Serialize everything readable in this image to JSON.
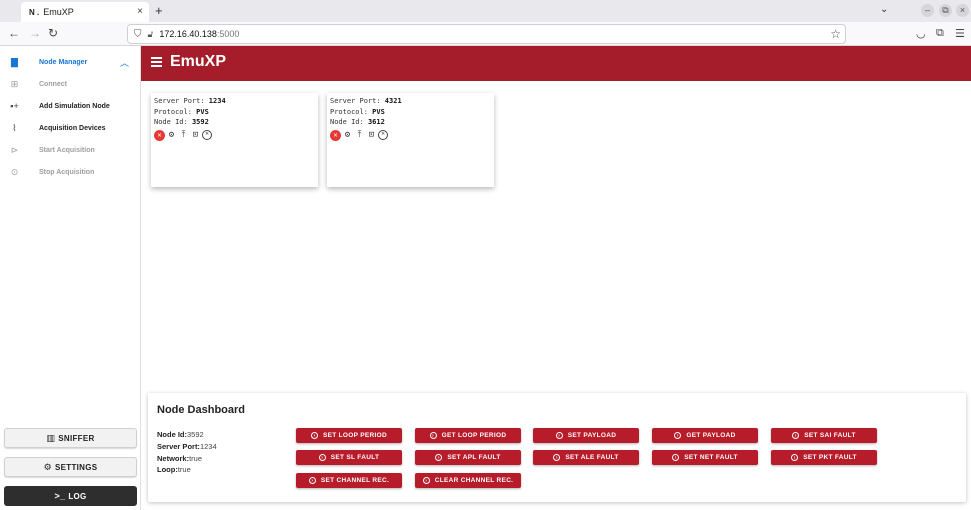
{
  "browser": {
    "tab_favicon": "N .",
    "tab_title": "EmuXP",
    "tab_close": "×",
    "new_tab": "+",
    "url_host": "172.16.40.138",
    "url_port": ":5000"
  },
  "sidebar": {
    "items": [
      {
        "label": "Node Manager",
        "icon": "node-manager-icon"
      },
      {
        "label": "Connect",
        "icon": "connect-icon"
      },
      {
        "label": "Add Simulation Node",
        "icon": "add-node-icon"
      },
      {
        "label": "Acquisition Devices",
        "icon": "device-icon"
      },
      {
        "label": "Start Acquisition",
        "icon": "play-icon"
      },
      {
        "label": "Stop Acquisition",
        "icon": "stop-icon"
      }
    ],
    "buttons": {
      "sniffer": "SNIFFER",
      "settings": "SETTINGS",
      "log": "LOG"
    }
  },
  "app": {
    "title": "EmuXP",
    "brand_color": "#a51c2a"
  },
  "nodes": [
    {
      "port_label": "Server Port:",
      "port": "1234",
      "protocol_label": "Protocol:",
      "protocol": "PVS",
      "id_label": "Node Id:",
      "id": "3592"
    },
    {
      "port_label": "Server Port:",
      "port": "4321",
      "protocol_label": "Protocol:",
      "protocol": "PVS",
      "id_label": "Node Id:",
      "id": "3612"
    }
  ],
  "dashboard": {
    "title": "Node Dashboard",
    "node_id_label": "Node Id:",
    "node_id": "3592",
    "server_port_label": "Server Port:",
    "server_port": "1234",
    "network_label": "Network:",
    "network": "true",
    "loop_label": "Loop:",
    "loop": "true",
    "buttons": [
      "SET LOOP PERIOD",
      "GET LOOP PERIOD",
      "SET PAYLOAD",
      "GET PAYLOAD",
      "SET SAI FAULT",
      "SET SL FAULT",
      "SET APL FAULT",
      "SET ALE FAULT",
      "SET NET FAULT",
      "SET PKT FAULT",
      "SET CHANNEL REC.",
      "CLEAR CHANNEL REC."
    ]
  }
}
